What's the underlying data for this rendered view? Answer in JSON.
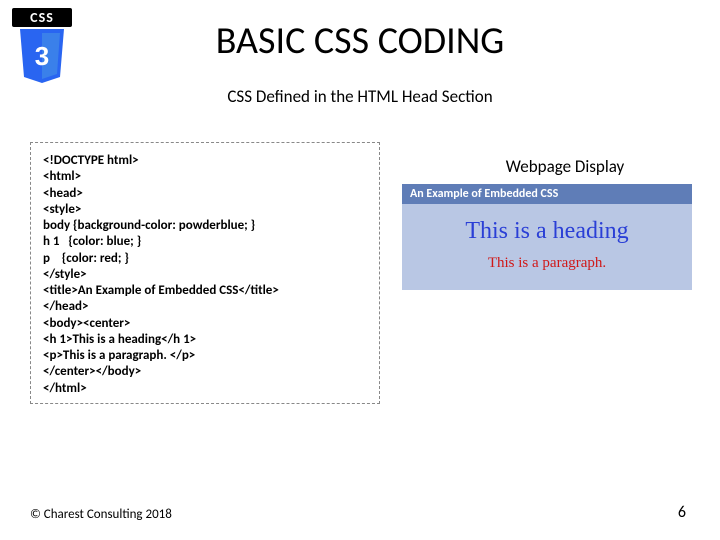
{
  "logo_text": "CSS",
  "logo_num": "3",
  "title": "BASIC CSS CODING",
  "subtitle": "CSS Defined in the HTML Head Section",
  "code": {
    "l0": "<!DOCTYPE html>",
    "l1": "<html>",
    "l2": "<head>",
    "l3": "<style>",
    "l4": "body {background-color: powderblue; }",
    "l5": "h 1   {color: blue; }",
    "l6": "p    {color: red; }",
    "l7": "</style>",
    "l8": "<title>An Example of Embedded CSS</title>",
    "l9": "</head>",
    "l10": "<body><center>",
    "l11": "<h 1>This is a heading</h 1>",
    "l12": "<p>This is a paragraph. </p>",
    "l13": "</center></body>",
    "l14": "</html>"
  },
  "preview": {
    "label": "Webpage Display",
    "titlebar": "An Example of Embedded CSS",
    "heading": "This is a heading",
    "paragraph": "This is a paragraph."
  },
  "footer": {
    "copyright": "© Charest Consulting 2018",
    "page": "6"
  }
}
